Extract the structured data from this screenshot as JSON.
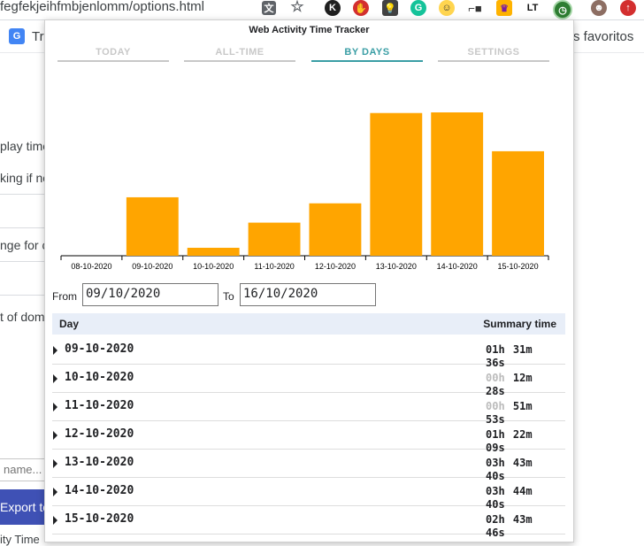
{
  "browser": {
    "url": "fegfekjeihfmbjenlomm/options.html",
    "bookmark_tr": "Tr",
    "bookmark_favorites": "s favoritos",
    "bookmark_g_icon": "G"
  },
  "background_page": {
    "text_1": "play time",
    "text_2": "king if no",
    "text_3": "nge for c",
    "text_4": "t of dom",
    "input_placeholder": "name...",
    "export_button": "Export to",
    "bottom_text": "ity Time"
  },
  "popup": {
    "title": "Web Activity Time Tracker",
    "tabs": [
      "TODAY",
      "ALL-TIME",
      "BY DAYS",
      "SETTINGS"
    ],
    "active_tab": "BY DAYS",
    "from_label": "From",
    "from_value": "09/10/2020",
    "to_label": "To",
    "to_value": "16/10/2020",
    "table": {
      "col_day": "Day",
      "col_summary": "Summary time",
      "rows": [
        {
          "date": "09-10-2020",
          "hours": "01h",
          "minutes": "31m",
          "seconds": "36s",
          "hours_dim": false
        },
        {
          "date": "10-10-2020",
          "hours": "00h",
          "minutes": "12m",
          "seconds": "28s",
          "hours_dim": true
        },
        {
          "date": "11-10-2020",
          "hours": "00h",
          "minutes": "51m",
          "seconds": "53s",
          "hours_dim": true
        },
        {
          "date": "12-10-2020",
          "hours": "01h",
          "minutes": "22m",
          "seconds": "09s",
          "hours_dim": false
        },
        {
          "date": "13-10-2020",
          "hours": "03h",
          "minutes": "43m",
          "seconds": "40s",
          "hours_dim": false
        },
        {
          "date": "14-10-2020",
          "hours": "03h",
          "minutes": "44m",
          "seconds": "40s",
          "hours_dim": false
        },
        {
          "date": "15-10-2020",
          "hours": "02h",
          "minutes": "43m",
          "seconds": "46s",
          "hours_dim": false
        }
      ]
    }
  },
  "chart_data": {
    "type": "bar",
    "categories": [
      "08-10-2020",
      "09-10-2020",
      "10-10-2020",
      "11-10-2020",
      "12-10-2020",
      "13-10-2020",
      "14-10-2020",
      "15-10-2020"
    ],
    "values": [
      0,
      5496,
      748,
      3113,
      4929,
      13420,
      13480,
      9826
    ],
    "value_unit": "seconds",
    "bar_color": "#ffa500",
    "grid": false,
    "legend": "none"
  },
  "colors": {
    "accent": "#3a9ea5",
    "bar": "#ffa500",
    "header_bg": "#e8eef8"
  },
  "icons": {
    "extensions": [
      "translate-icon",
      "star-icon",
      "k-icon",
      "stop-hand-icon",
      "lightbulb-icon",
      "grammarly-icon",
      "face-icon",
      "glasses-icon",
      "trophy-icon",
      "lt-icon",
      "timer-icon",
      "avatar-icon",
      "update-icon"
    ]
  }
}
